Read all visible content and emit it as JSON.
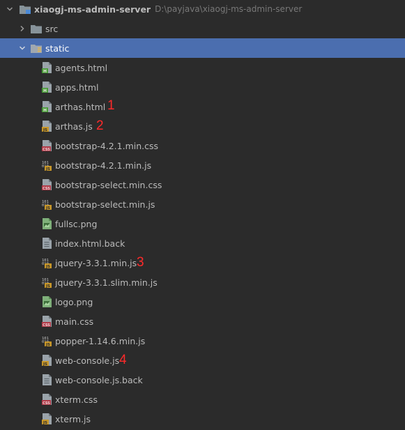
{
  "project": {
    "name": "xiaogj-ms-admin-server",
    "path": "D:\\payjava\\xiaogj-ms-admin-server"
  },
  "folders": [
    {
      "label": "src",
      "expanded": false
    },
    {
      "label": "static",
      "expanded": true
    }
  ],
  "files": [
    {
      "label": "agents.html",
      "type": "html"
    },
    {
      "label": "apps.html",
      "type": "html"
    },
    {
      "label": "arthas.html",
      "type": "html"
    },
    {
      "label": "arthas.js",
      "type": "js"
    },
    {
      "label": "bootstrap-4.2.1.min.css",
      "type": "css"
    },
    {
      "label": "bootstrap-4.2.1.min.js",
      "type": "minjs"
    },
    {
      "label": "bootstrap-select.min.css",
      "type": "css"
    },
    {
      "label": "bootstrap-select.min.js",
      "type": "minjs"
    },
    {
      "label": "fullsc.png",
      "type": "png"
    },
    {
      "label": "index.html.back",
      "type": "text"
    },
    {
      "label": "jquery-3.3.1.min.js",
      "type": "minjs"
    },
    {
      "label": "jquery-3.3.1.slim.min.js",
      "type": "minjs"
    },
    {
      "label": "logo.png",
      "type": "png"
    },
    {
      "label": "main.css",
      "type": "css"
    },
    {
      "label": "popper-1.14.6.min.js",
      "type": "minjs"
    },
    {
      "label": "web-console.js",
      "type": "js"
    },
    {
      "label": "web-console.js.back",
      "type": "text"
    },
    {
      "label": "xterm.css",
      "type": "css"
    },
    {
      "label": "xterm.js",
      "type": "js"
    }
  ],
  "annotations": [
    "1",
    "2",
    "3",
    "4"
  ],
  "colors": {
    "background": "#2b2b2b",
    "selection": "#4b6eaf",
    "annotation": "#ff2a2a",
    "folder": "#87939a"
  }
}
